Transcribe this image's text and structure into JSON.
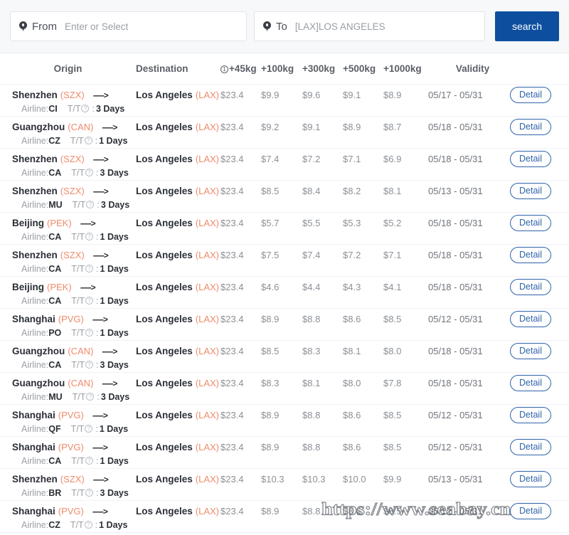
{
  "search": {
    "from": {
      "icon": "location-pin-icon",
      "label": "From",
      "value": "",
      "placeholder": "Enter or Select"
    },
    "to": {
      "icon": "location-pin-icon",
      "label": "To",
      "value": "[LAX]LOS ANGELES",
      "placeholder": ""
    },
    "search_button": "search",
    "accent_color": "#0d4f9e"
  },
  "table": {
    "headers": {
      "origin": "Origin",
      "destination": "Destination",
      "p45": "+45kg",
      "p45_icon": "info-circle-icon",
      "p100": "+100kg",
      "p300": "+300kg",
      "p500": "+500kg",
      "p1000": "+1000kg",
      "validity": "Validity"
    },
    "labels": {
      "arrow": "----->",
      "airline_prefix": "Airline:",
      "tt_label": "T/T",
      "tt_icon": "question-circle-icon",
      "tt_separator": ":",
      "detail": "Detail"
    },
    "code_color": "#ef8a6b",
    "rows": [
      {
        "origin_city": "Shenzhen",
        "origin_code": "(SZX)",
        "dest_city": "Los Angeles",
        "dest_code": "(LAX)",
        "p45": "$23.4",
        "p100": "$9.9",
        "p300": "$9.6",
        "p500": "$9.1",
        "p1000": "$8.9",
        "validity": "05/17 - 05/31",
        "airline": "CI",
        "tt": "3 Days",
        "detail": "Detail"
      },
      {
        "origin_city": "Guangzhou",
        "origin_code": "(CAN)",
        "dest_city": "Los Angeles",
        "dest_code": "(LAX)",
        "p45": "$23.4",
        "p100": "$9.2",
        "p300": "$9.1",
        "p500": "$8.9",
        "p1000": "$8.7",
        "validity": "05/18 - 05/31",
        "airline": "CZ",
        "tt": "1 Days",
        "detail": "Detail"
      },
      {
        "origin_city": "Shenzhen",
        "origin_code": "(SZX)",
        "dest_city": "Los Angeles",
        "dest_code": "(LAX)",
        "p45": "$23.4",
        "p100": "$7.4",
        "p300": "$7.2",
        "p500": "$7.1",
        "p1000": "$6.9",
        "validity": "05/18 - 05/31",
        "airline": "CA",
        "tt": "3 Days",
        "detail": "Detail"
      },
      {
        "origin_city": "Shenzhen",
        "origin_code": "(SZX)",
        "dest_city": "Los Angeles",
        "dest_code": "(LAX)",
        "p45": "$23.4",
        "p100": "$8.5",
        "p300": "$8.4",
        "p500": "$8.2",
        "p1000": "$8.1",
        "validity": "05/13 - 05/31",
        "airline": "MU",
        "tt": "3 Days",
        "detail": "Detail"
      },
      {
        "origin_city": "Beijing",
        "origin_code": "(PEK)",
        "dest_city": "Los Angeles",
        "dest_code": "(LAX)",
        "p45": "$23.4",
        "p100": "$5.7",
        "p300": "$5.5",
        "p500": "$5.3",
        "p1000": "$5.2",
        "validity": "05/18 - 05/31",
        "airline": "CA",
        "tt": "1 Days",
        "detail": "Detail"
      },
      {
        "origin_city": "Shenzhen",
        "origin_code": "(SZX)",
        "dest_city": "Los Angeles",
        "dest_code": "(LAX)",
        "p45": "$23.4",
        "p100": "$7.5",
        "p300": "$7.4",
        "p500": "$7.2",
        "p1000": "$7.1",
        "validity": "05/18 - 05/31",
        "airline": "CA",
        "tt": "1 Days",
        "detail": "Detail"
      },
      {
        "origin_city": "Beijing",
        "origin_code": "(PEK)",
        "dest_city": "Los Angeles",
        "dest_code": "(LAX)",
        "p45": "$23.4",
        "p100": "$4.6",
        "p300": "$4.4",
        "p500": "$4.3",
        "p1000": "$4.1",
        "validity": "05/18 - 05/31",
        "airline": "CA",
        "tt": "1 Days",
        "detail": "Detail"
      },
      {
        "origin_city": "Shanghai",
        "origin_code": "(PVG)",
        "dest_city": "Los Angeles",
        "dest_code": "(LAX)",
        "p45": "$23.4",
        "p100": "$8.9",
        "p300": "$8.8",
        "p500": "$8.6",
        "p1000": "$8.5",
        "validity": "05/12 - 05/31",
        "airline": "PO",
        "tt": "1 Days",
        "detail": "Detail"
      },
      {
        "origin_city": "Guangzhou",
        "origin_code": "(CAN)",
        "dest_city": "Los Angeles",
        "dest_code": "(LAX)",
        "p45": "$23.4",
        "p100": "$8.5",
        "p300": "$8.3",
        "p500": "$8.1",
        "p1000": "$8.0",
        "validity": "05/18 - 05/31",
        "airline": "CA",
        "tt": "3 Days",
        "detail": "Detail"
      },
      {
        "origin_city": "Guangzhou",
        "origin_code": "(CAN)",
        "dest_city": "Los Angeles",
        "dest_code": "(LAX)",
        "p45": "$23.4",
        "p100": "$8.3",
        "p300": "$8.1",
        "p500": "$8.0",
        "p1000": "$7.8",
        "validity": "05/18 - 05/31",
        "airline": "MU",
        "tt": "3 Days",
        "detail": "Detail"
      },
      {
        "origin_city": "Shanghai",
        "origin_code": "(PVG)",
        "dest_city": "Los Angeles",
        "dest_code": "(LAX)",
        "p45": "$23.4",
        "p100": "$8.9",
        "p300": "$8.8",
        "p500": "$8.6",
        "p1000": "$8.5",
        "validity": "05/12 - 05/31",
        "airline": "QF",
        "tt": "1 Days",
        "detail": "Detail"
      },
      {
        "origin_city": "Shanghai",
        "origin_code": "(PVG)",
        "dest_city": "Los Angeles",
        "dest_code": "(LAX)",
        "p45": "$23.4",
        "p100": "$8.9",
        "p300": "$8.8",
        "p500": "$8.6",
        "p1000": "$8.5",
        "validity": "05/12 - 05/31",
        "airline": "CA",
        "tt": "1 Days",
        "detail": "Detail"
      },
      {
        "origin_city": "Shenzhen",
        "origin_code": "(SZX)",
        "dest_city": "Los Angeles",
        "dest_code": "(LAX)",
        "p45": "$23.4",
        "p100": "$10.3",
        "p300": "$10.3",
        "p500": "$10.0",
        "p1000": "$9.9",
        "validity": "05/13 - 05/31",
        "airline": "BR",
        "tt": "3 Days",
        "detail": "Detail"
      },
      {
        "origin_city": "Shanghai",
        "origin_code": "(PVG)",
        "dest_city": "Los Angeles",
        "dest_code": "(LAX)",
        "p45": "$23.4",
        "p100": "$8.9",
        "p300": "$8.8",
        "p500": "$8.6",
        "p1000": "$8.5",
        "validity": "05/12 - 05/31",
        "airline": "CZ",
        "tt": "1 Days",
        "detail": "Detail"
      }
    ]
  },
  "watermark": {
    "text": "https://www.seabay.cn"
  }
}
